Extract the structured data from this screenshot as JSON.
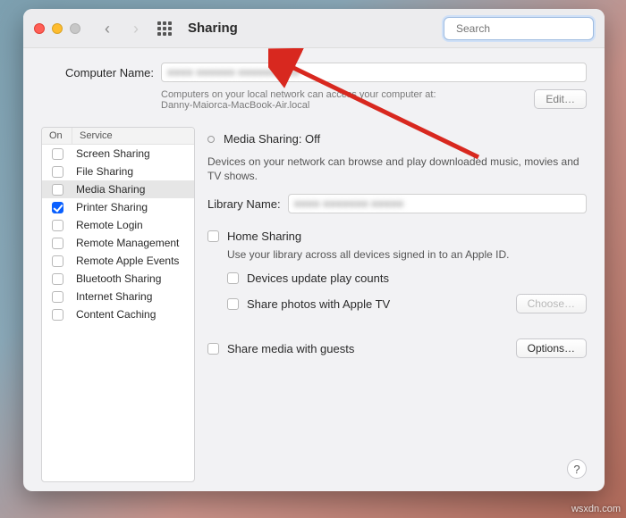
{
  "titlebar": {
    "title": "Sharing",
    "search_placeholder": "Search"
  },
  "computer_name": {
    "label": "Computer Name:",
    "value_obscured": "■■■■ ■■■■■■ ■■■■■■■ ■■",
    "subtext_line1": "Computers on your local network can access your computer at:",
    "subtext_line2": "Danny-Maiorca-MacBook-Air.local",
    "edit_btn": "Edit…"
  },
  "sidebar": {
    "col_on": "On",
    "col_service": "Service",
    "items": [
      {
        "label": "Screen Sharing",
        "on": false
      },
      {
        "label": "File Sharing",
        "on": false
      },
      {
        "label": "Media Sharing",
        "on": false,
        "selected": true
      },
      {
        "label": "Printer Sharing",
        "on": true
      },
      {
        "label": "Remote Login",
        "on": false
      },
      {
        "label": "Remote Management",
        "on": false
      },
      {
        "label": "Remote Apple Events",
        "on": false
      },
      {
        "label": "Bluetooth Sharing",
        "on": false
      },
      {
        "label": "Internet Sharing",
        "on": false
      },
      {
        "label": "Content Caching",
        "on": false
      }
    ]
  },
  "pane": {
    "status": "Media Sharing: Off",
    "desc": "Devices on your network can browse and play downloaded music, movies and TV shows.",
    "library_label": "Library Name:",
    "library_value_obscured": "■■■■ ■■■■■■■ ■■■■■",
    "home_sharing": "Home Sharing",
    "home_sharing_desc": "Use your library across all devices signed in to an Apple ID.",
    "opt_counts": "Devices update play counts",
    "opt_photos": "Share photos with Apple TV",
    "choose_btn": "Choose…",
    "share_guests": "Share media with guests",
    "options_btn": "Options…"
  },
  "watermark": "wsxdn.com"
}
